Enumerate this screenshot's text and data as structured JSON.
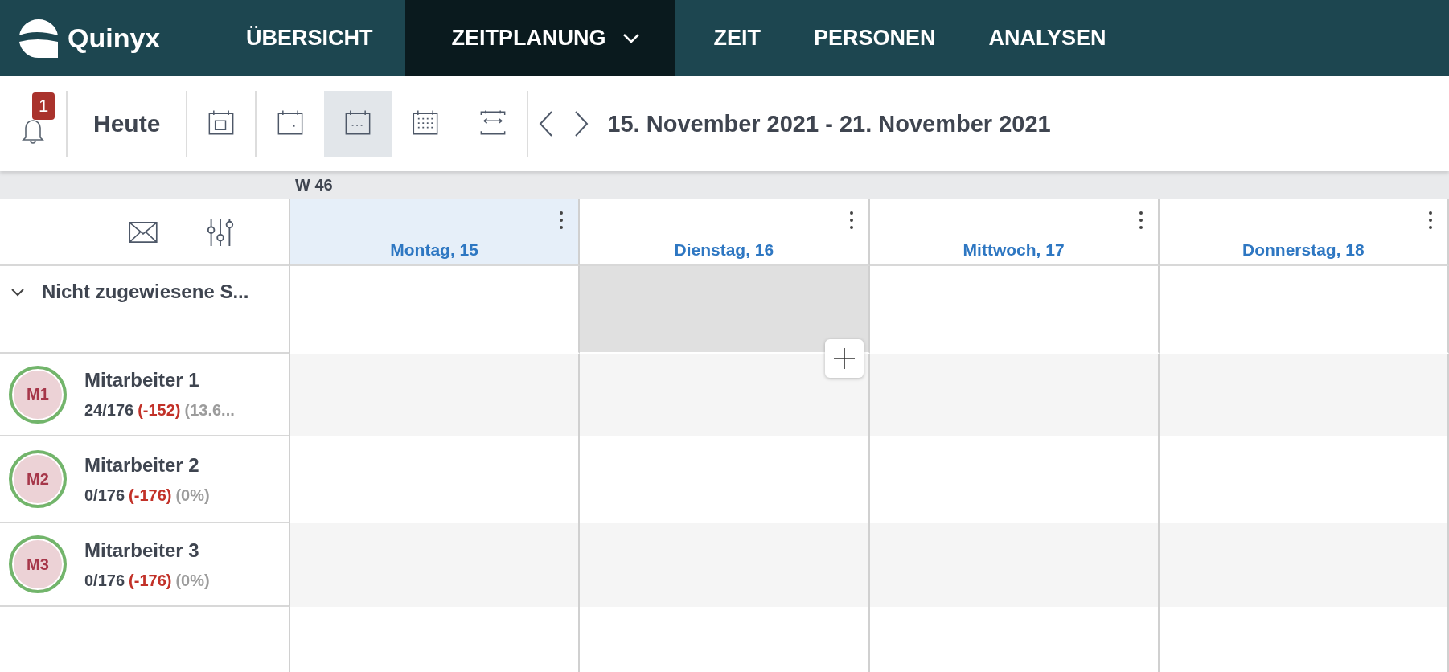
{
  "nav": {
    "logo": "Quinyx",
    "items": [
      {
        "label": "ÜBERSICHT",
        "selected": false,
        "dropdown": false
      },
      {
        "label": "ZEITPLANUNG",
        "selected": true,
        "dropdown": true
      },
      {
        "label": "ZEIT",
        "selected": false,
        "dropdown": false
      },
      {
        "label": "PERSONEN",
        "selected": false,
        "dropdown": false
      },
      {
        "label": "ANALYSEN",
        "selected": false,
        "dropdown": false
      }
    ]
  },
  "toolbar": {
    "notification_count": "1",
    "today": "Heute",
    "views": [
      {
        "kind": "day",
        "selected": false
      },
      {
        "kind": "day-dot",
        "selected": false
      },
      {
        "kind": "week",
        "selected": true
      },
      {
        "kind": "month",
        "selected": false
      },
      {
        "kind": "range",
        "selected": false
      }
    ],
    "date_range": "15. November 2021 - 21. November 2021"
  },
  "week_label": "W 46",
  "days": [
    {
      "label": "Montag, 15",
      "selected": true
    },
    {
      "label": "Dienstag, 16",
      "selected": false
    },
    {
      "label": "Mittwoch, 17",
      "selected": false
    },
    {
      "label": "Donnerstag, 18",
      "selected": false
    }
  ],
  "unassigned": {
    "label": "Nicht zugewiesene S...",
    "expanded": true,
    "cells": [
      {
        "hovered": false
      },
      {
        "hovered": true
      },
      {
        "hovered": false
      },
      {
        "hovered": false
      }
    ]
  },
  "employees": [
    {
      "initials": "M1",
      "name": "Mitarbeiter 1",
      "hours": "24/176",
      "deficit": "(-152)",
      "percent": "(13.6..."
    },
    {
      "initials": "M2",
      "name": "Mitarbeiter 2",
      "hours": "0/176",
      "deficit": "(-176)",
      "percent": "(0%)"
    },
    {
      "initials": "M3",
      "name": "Mitarbeiter 3",
      "hours": "0/176",
      "deficit": "(-176)",
      "percent": "(0%)"
    }
  ]
}
